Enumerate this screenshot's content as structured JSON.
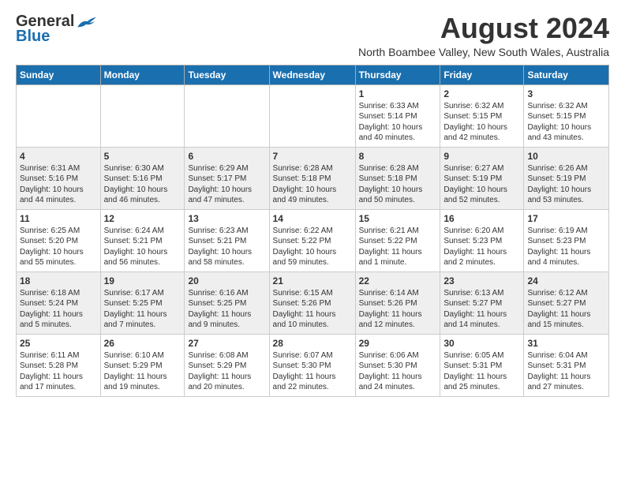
{
  "header": {
    "logo_general": "General",
    "logo_blue": "Blue",
    "month_year": "August 2024",
    "location": "North Boambee Valley, New South Wales, Australia"
  },
  "weekdays": [
    "Sunday",
    "Monday",
    "Tuesday",
    "Wednesday",
    "Thursday",
    "Friday",
    "Saturday"
  ],
  "weeks": [
    [
      {
        "day": "",
        "info": ""
      },
      {
        "day": "",
        "info": ""
      },
      {
        "day": "",
        "info": ""
      },
      {
        "day": "",
        "info": ""
      },
      {
        "day": "1",
        "info": "Sunrise: 6:33 AM\nSunset: 5:14 PM\nDaylight: 10 hours\nand 40 minutes."
      },
      {
        "day": "2",
        "info": "Sunrise: 6:32 AM\nSunset: 5:15 PM\nDaylight: 10 hours\nand 42 minutes."
      },
      {
        "day": "3",
        "info": "Sunrise: 6:32 AM\nSunset: 5:15 PM\nDaylight: 10 hours\nand 43 minutes."
      }
    ],
    [
      {
        "day": "4",
        "info": "Sunrise: 6:31 AM\nSunset: 5:16 PM\nDaylight: 10 hours\nand 44 minutes."
      },
      {
        "day": "5",
        "info": "Sunrise: 6:30 AM\nSunset: 5:16 PM\nDaylight: 10 hours\nand 46 minutes."
      },
      {
        "day": "6",
        "info": "Sunrise: 6:29 AM\nSunset: 5:17 PM\nDaylight: 10 hours\nand 47 minutes."
      },
      {
        "day": "7",
        "info": "Sunrise: 6:28 AM\nSunset: 5:18 PM\nDaylight: 10 hours\nand 49 minutes."
      },
      {
        "day": "8",
        "info": "Sunrise: 6:28 AM\nSunset: 5:18 PM\nDaylight: 10 hours\nand 50 minutes."
      },
      {
        "day": "9",
        "info": "Sunrise: 6:27 AM\nSunset: 5:19 PM\nDaylight: 10 hours\nand 52 minutes."
      },
      {
        "day": "10",
        "info": "Sunrise: 6:26 AM\nSunset: 5:19 PM\nDaylight: 10 hours\nand 53 minutes."
      }
    ],
    [
      {
        "day": "11",
        "info": "Sunrise: 6:25 AM\nSunset: 5:20 PM\nDaylight: 10 hours\nand 55 minutes."
      },
      {
        "day": "12",
        "info": "Sunrise: 6:24 AM\nSunset: 5:21 PM\nDaylight: 10 hours\nand 56 minutes."
      },
      {
        "day": "13",
        "info": "Sunrise: 6:23 AM\nSunset: 5:21 PM\nDaylight: 10 hours\nand 58 minutes."
      },
      {
        "day": "14",
        "info": "Sunrise: 6:22 AM\nSunset: 5:22 PM\nDaylight: 10 hours\nand 59 minutes."
      },
      {
        "day": "15",
        "info": "Sunrise: 6:21 AM\nSunset: 5:22 PM\nDaylight: 11 hours\nand 1 minute."
      },
      {
        "day": "16",
        "info": "Sunrise: 6:20 AM\nSunset: 5:23 PM\nDaylight: 11 hours\nand 2 minutes."
      },
      {
        "day": "17",
        "info": "Sunrise: 6:19 AM\nSunset: 5:23 PM\nDaylight: 11 hours\nand 4 minutes."
      }
    ],
    [
      {
        "day": "18",
        "info": "Sunrise: 6:18 AM\nSunset: 5:24 PM\nDaylight: 11 hours\nand 5 minutes."
      },
      {
        "day": "19",
        "info": "Sunrise: 6:17 AM\nSunset: 5:25 PM\nDaylight: 11 hours\nand 7 minutes."
      },
      {
        "day": "20",
        "info": "Sunrise: 6:16 AM\nSunset: 5:25 PM\nDaylight: 11 hours\nand 9 minutes."
      },
      {
        "day": "21",
        "info": "Sunrise: 6:15 AM\nSunset: 5:26 PM\nDaylight: 11 hours\nand 10 minutes."
      },
      {
        "day": "22",
        "info": "Sunrise: 6:14 AM\nSunset: 5:26 PM\nDaylight: 11 hours\nand 12 minutes."
      },
      {
        "day": "23",
        "info": "Sunrise: 6:13 AM\nSunset: 5:27 PM\nDaylight: 11 hours\nand 14 minutes."
      },
      {
        "day": "24",
        "info": "Sunrise: 6:12 AM\nSunset: 5:27 PM\nDaylight: 11 hours\nand 15 minutes."
      }
    ],
    [
      {
        "day": "25",
        "info": "Sunrise: 6:11 AM\nSunset: 5:28 PM\nDaylight: 11 hours\nand 17 minutes."
      },
      {
        "day": "26",
        "info": "Sunrise: 6:10 AM\nSunset: 5:29 PM\nDaylight: 11 hours\nand 19 minutes."
      },
      {
        "day": "27",
        "info": "Sunrise: 6:08 AM\nSunset: 5:29 PM\nDaylight: 11 hours\nand 20 minutes."
      },
      {
        "day": "28",
        "info": "Sunrise: 6:07 AM\nSunset: 5:30 PM\nDaylight: 11 hours\nand 22 minutes."
      },
      {
        "day": "29",
        "info": "Sunrise: 6:06 AM\nSunset: 5:30 PM\nDaylight: 11 hours\nand 24 minutes."
      },
      {
        "day": "30",
        "info": "Sunrise: 6:05 AM\nSunset: 5:31 PM\nDaylight: 11 hours\nand 25 minutes."
      },
      {
        "day": "31",
        "info": "Sunrise: 6:04 AM\nSunset: 5:31 PM\nDaylight: 11 hours\nand 27 minutes."
      }
    ]
  ]
}
